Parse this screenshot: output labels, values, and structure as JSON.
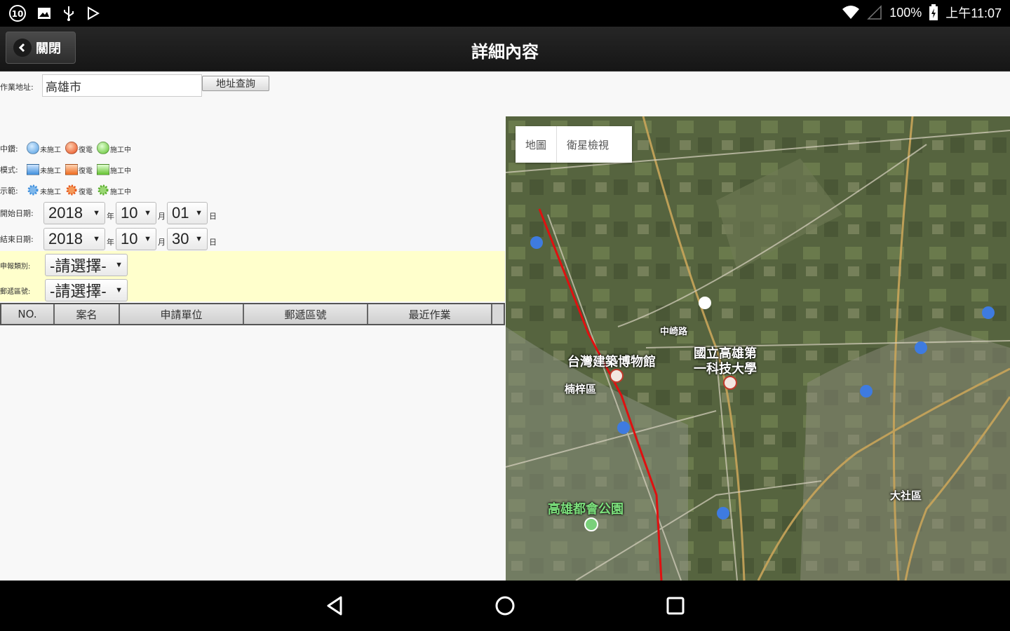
{
  "status_bar": {
    "battery": "100%",
    "time": "上午11:07",
    "left_icons": [
      "notification-icon",
      "image-icon",
      "usb-icon",
      "play-store-icon"
    ]
  },
  "action_bar": {
    "back_label": "關閉",
    "title": "詳細內容"
  },
  "form": {
    "address_label": "作業地址:",
    "address_value": "高雄市",
    "address_button": "地址查詢",
    "legend": [
      {
        "label": "中鑽:",
        "items": [
          "未施工",
          "復電",
          "施工中"
        ]
      },
      {
        "label": "模式:",
        "items": [
          "未施工",
          "復電",
          "施工中"
        ]
      },
      {
        "label": "示範:",
        "items": [
          "未施工",
          "復電",
          "施工中"
        ]
      }
    ],
    "start_date": {
      "label": "開始日期:",
      "year": "2018",
      "month": "10",
      "day": "01",
      "y_unit": "年",
      "m_unit": "月",
      "d_unit": "日"
    },
    "end_date": {
      "label": "結束日期:",
      "year": "2018",
      "month": "10",
      "day": "30",
      "y_unit": "年",
      "m_unit": "月",
      "d_unit": "日"
    },
    "filter1": {
      "label": "申報類別:",
      "value": "-請選擇-"
    },
    "filter2": {
      "label": "郵遞區號:",
      "value": "-請選擇-"
    }
  },
  "table": {
    "headers": [
      "NO.",
      "案名",
      "申請單位",
      "郵遞區號",
      "最近作業"
    ]
  },
  "map": {
    "toggle": [
      "地圖",
      "衛星檢視"
    ],
    "labels": [
      "台灣建築博物館",
      "國立高雄第",
      "一科技大學",
      "楠梓區",
      "高雄都會公園",
      "大社區",
      "中崎路"
    ]
  },
  "colors": {
    "status_bg": "#000000",
    "actionbar_bg": "#1f1f1f",
    "filter_bg": "#ffffcc",
    "route": "#e01010"
  }
}
